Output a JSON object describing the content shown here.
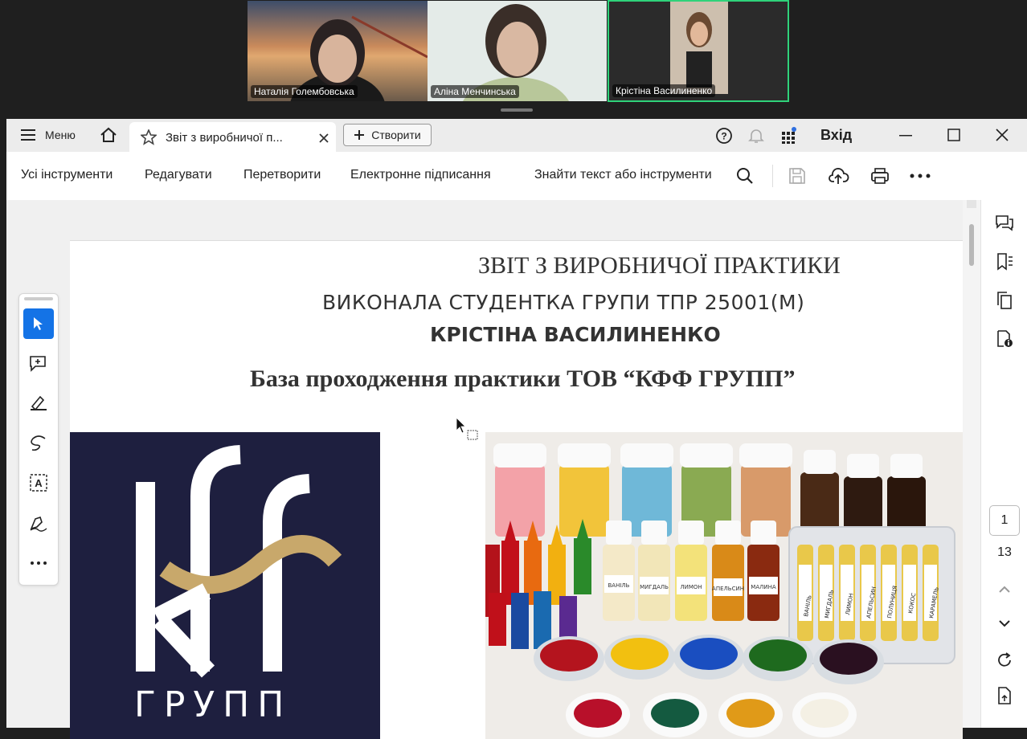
{
  "participants": [
    {
      "name": "Наталія Голембовська"
    },
    {
      "name": "Аліна Менчинська"
    },
    {
      "name": "Крістіна Василиненко"
    }
  ],
  "titlebar": {
    "menu_label": "Меню",
    "tab_title": "Звіт з виробничої п...",
    "create_label": "Створити",
    "signin_label": "Вхід"
  },
  "toolbar": {
    "all_tools": "Усі інструменти",
    "edit": "Редагувати",
    "convert": "Перетворити",
    "esign": "Електронне підписання",
    "search_label": "Знайти текст або інструменти"
  },
  "document": {
    "title": "ЗВІТ З ВИРОБНИЧОЇ ПРАКТИКИ",
    "subtitle": "ВИКОНАЛА СТУДЕНТКА ГРУПИ ТПР 25001(М)",
    "student": "КРІСТІНА ВАСИЛИНЕНКО",
    "base": "База проходження практики ТОВ “КФФ ГРУПП”",
    "logo_text": "ГРУПП",
    "logo_colors": {
      "bg": "#1e1f3f",
      "letters": "#ffffff",
      "wave": "#c8a86b"
    },
    "bottle_labels": [
      "ВАНІЛЬ",
      "МИГДАЛЬ",
      "ЛИМОН",
      "АПЕЛЬСИН",
      "МАЛИНА"
    ],
    "vial_labels": [
      "ВАНІЛЬ",
      "МИГДАЛЬ",
      "ЛИМОН",
      "АПЕЛЬСИН",
      "ПОЛУНИЦЯ",
      "КОКОС",
      "КАРАМЕЛЬ"
    ]
  },
  "pagination": {
    "current": "1",
    "total": "13"
  }
}
